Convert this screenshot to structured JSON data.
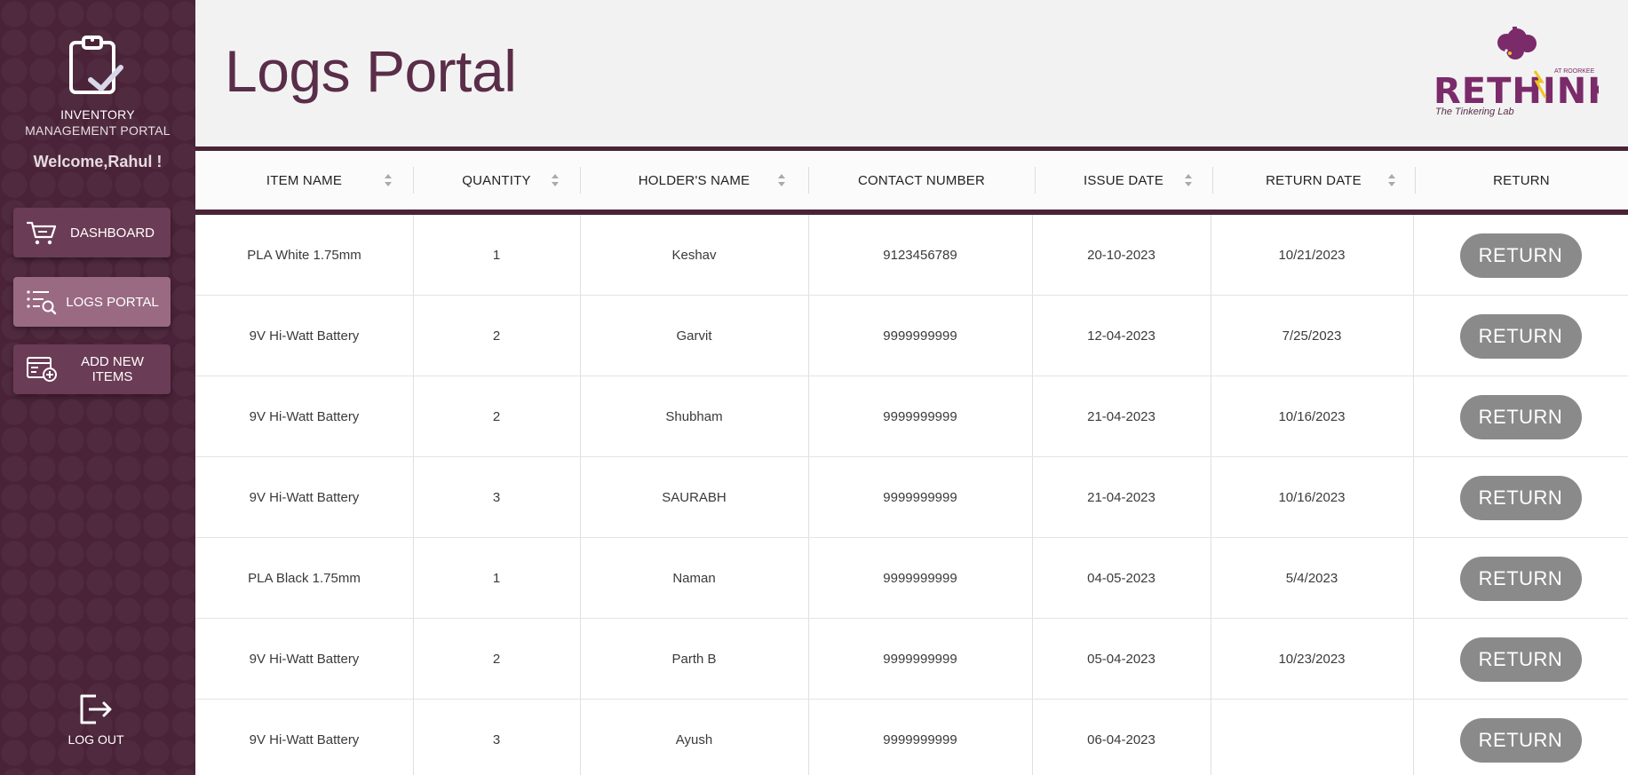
{
  "sidebar": {
    "brand_line1": "INVENTORY",
    "brand_line2": "MANAGEMENT PORTAL",
    "welcome": "Welcome,Rahul !",
    "nav": [
      {
        "label": "DASHBOARD",
        "icon": "cart-icon"
      },
      {
        "label": "LOGS PORTAL",
        "icon": "list-search-icon",
        "active": true
      },
      {
        "label": "ADD NEW ITEMS",
        "icon": "add-item-icon"
      }
    ],
    "logout_label": "LOG OUT"
  },
  "header": {
    "title": "Logs Portal",
    "logo": {
      "main": "RETHINK!",
      "tagline": "The Tinkering Lab",
      "small": "AT ROORKEE"
    }
  },
  "table": {
    "columns": [
      {
        "label": "ITEM NAME",
        "sortable": true
      },
      {
        "label": "QUANTITY",
        "sortable": true
      },
      {
        "label": "HOLDER'S NAME",
        "sortable": true
      },
      {
        "label": "CONTACT NUMBER",
        "sortable": false
      },
      {
        "label": "ISSUE DATE",
        "sortable": true
      },
      {
        "label": "RETURN DATE",
        "sortable": true
      },
      {
        "label": "RETURN",
        "sortable": false
      }
    ],
    "return_button_label": "RETURN",
    "rows": [
      {
        "item": "PLA White 1.75mm",
        "qty": "1",
        "holder": "Keshav",
        "contact": "9123456789",
        "issue": "20-10-2023",
        "return": "10/21/2023"
      },
      {
        "item": "9V Hi-Watt Battery",
        "qty": "2",
        "holder": "Garvit",
        "contact": "9999999999",
        "issue": "12-04-2023",
        "return": "7/25/2023"
      },
      {
        "item": "9V Hi-Watt Battery",
        "qty": "2",
        "holder": "Shubham",
        "contact": "9999999999",
        "issue": "21-04-2023",
        "return": "10/16/2023"
      },
      {
        "item": "9V Hi-Watt Battery",
        "qty": "3",
        "holder": "SAURABH",
        "contact": "9999999999",
        "issue": "21-04-2023",
        "return": "10/16/2023"
      },
      {
        "item": "PLA Black 1.75mm",
        "qty": "1",
        "holder": "Naman",
        "contact": "9999999999",
        "issue": "04-05-2023",
        "return": "5/4/2023"
      },
      {
        "item": "9V Hi-Watt Battery",
        "qty": "2",
        "holder": "Parth B",
        "contact": "9999999999",
        "issue": "05-04-2023",
        "return": "10/23/2023"
      },
      {
        "item": "9V Hi-Watt Battery",
        "qty": "3",
        "holder": "Ayush",
        "contact": "9999999999",
        "issue": "06-04-2023",
        "return": ""
      }
    ]
  },
  "colors": {
    "sidebar": "#4a2338",
    "accent": "#5a2d48",
    "button_gray": "#8a8a8a",
    "logo_purple": "#7b2a6a",
    "logo_yellow": "#f2c51c"
  }
}
